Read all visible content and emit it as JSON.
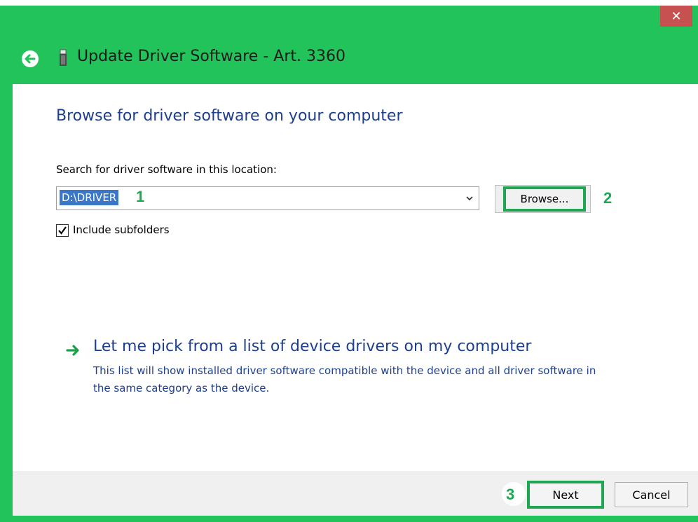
{
  "window": {
    "title": "Update Driver Software - Art. 3360",
    "close_glyph": "✕",
    "accent_color": "#22c35a"
  },
  "page": {
    "heading": "Browse for driver software on your computer",
    "search_label": "Search for driver software in this location:",
    "path_value": "D:\\DRIVER",
    "browse_label": "Browse...",
    "include_subfolders_label": "Include subfolders",
    "include_subfolders_checked": true,
    "pick_link": "Let me pick from a list of device drivers on my computer",
    "pick_description": "This list will show installed driver software compatible with the device and all driver software in the same category as the device."
  },
  "annotations": {
    "step1": "1",
    "step2": "2",
    "step3": "3"
  },
  "footer": {
    "next_label": "Next",
    "cancel_label": "Cancel"
  }
}
